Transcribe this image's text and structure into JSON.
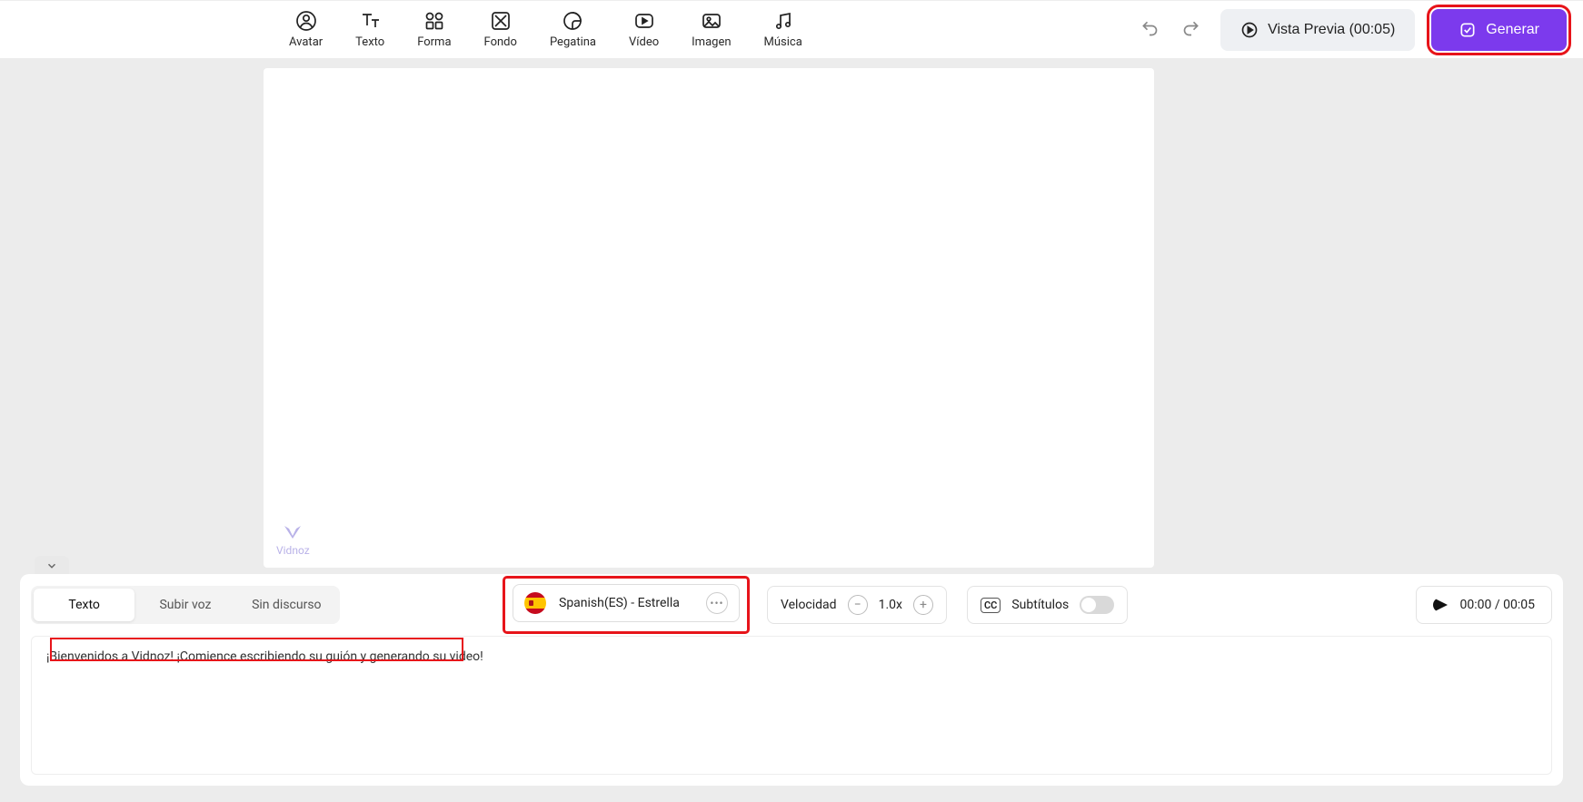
{
  "toolbar": {
    "items": [
      {
        "label": "Avatar"
      },
      {
        "label": "Texto"
      },
      {
        "label": "Forma"
      },
      {
        "label": "Fondo"
      },
      {
        "label": "Pegatina"
      },
      {
        "label": "Vídeo"
      },
      {
        "label": "Imagen"
      },
      {
        "label": "Música"
      }
    ],
    "preview_label": "Vista Previa (00:05)",
    "generate_label": "Generar"
  },
  "watermark": "Vidnoz",
  "bottom": {
    "tabs": [
      "Texto",
      "Subir voz",
      "Sin discurso"
    ],
    "active_tab": 0,
    "voice_label": "Spanish(ES) - Estrella",
    "speed": {
      "label": "Velocidad",
      "value": "1.0x"
    },
    "subtitles_label": "Subtítulos",
    "time": "00:00 / 00:05",
    "script_value": "¡Bienvenidos a Vidnoz! ¡Comience escribiendo su guión y generando su video!"
  }
}
